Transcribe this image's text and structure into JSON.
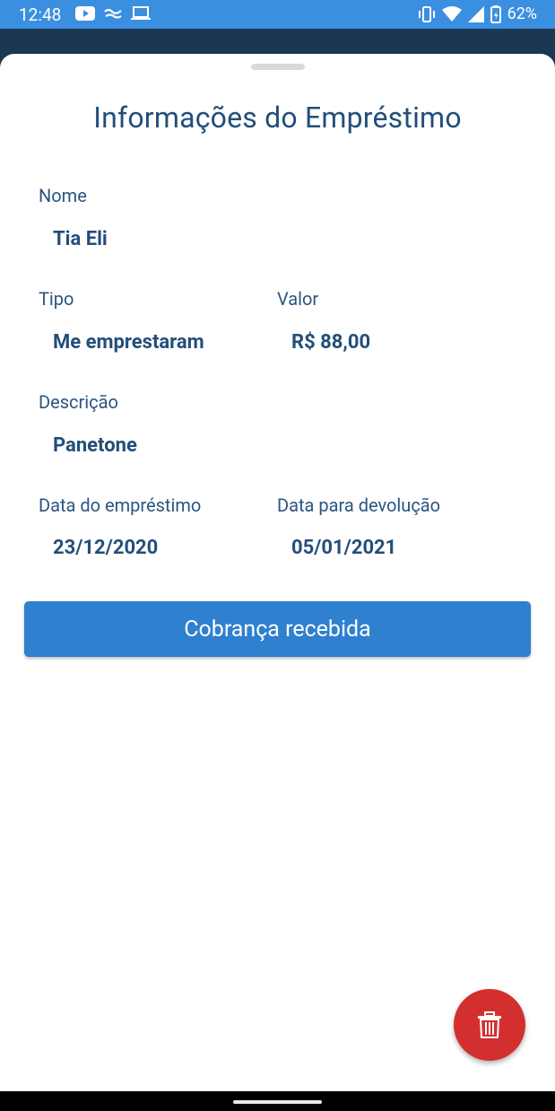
{
  "status_bar": {
    "time": "12:48",
    "battery": "62%",
    "icons": [
      "youtube-icon",
      "notification-icon",
      "laptop-icon",
      "vibrate-icon",
      "wifi-icon",
      "signal-icon",
      "battery-icon"
    ]
  },
  "sheet": {
    "title": "Informações do Empréstimo",
    "fields": {
      "nome": {
        "label": "Nome",
        "value": "Tia Eli"
      },
      "tipo": {
        "label": "Tipo",
        "value": "Me emprestaram"
      },
      "valor": {
        "label": "Valor",
        "value": "R$ 88,00"
      },
      "descricao": {
        "label": "Descrição",
        "value": "Panetone"
      },
      "data_emprestimo": {
        "label": "Data do empréstimo",
        "value": "23/12/2020"
      },
      "data_devolucao": {
        "label": "Data para devolução",
        "value": "05/01/2021"
      }
    },
    "primary_button": "Cobrança recebida",
    "fab_icon": "trash-icon"
  },
  "colors": {
    "status_bar": "#3b8fe0",
    "header_dark": "#1b3752",
    "text_primary": "#224e7b",
    "button": "#2f80cf",
    "fab": "#d32f2f"
  }
}
